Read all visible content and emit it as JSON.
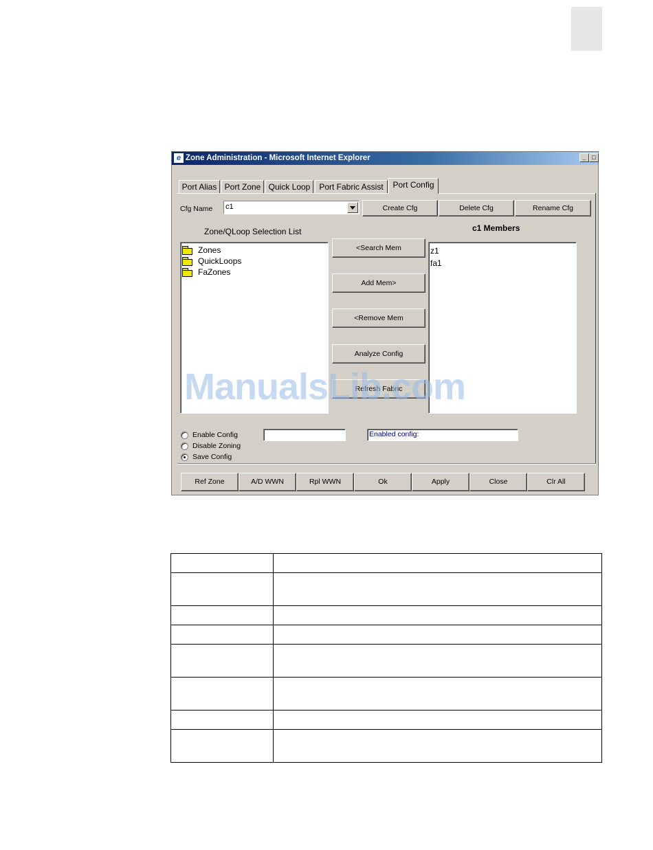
{
  "window": {
    "title": "Zone Administration - Microsoft Internet Explorer",
    "icon": "ie-icon",
    "controls": [
      "minimize-icon",
      "maximize-icon"
    ]
  },
  "tabs": [
    {
      "label": "Port Alias",
      "active": false
    },
    {
      "label": "Port Zone",
      "active": false
    },
    {
      "label": "Quick Loop",
      "active": false
    },
    {
      "label": "Port Fabric Assist",
      "active": false
    },
    {
      "label": "Port Config",
      "active": true
    }
  ],
  "cfg": {
    "name_label": "Cfg Name",
    "name_value": "c1",
    "create_label": "Create Cfg",
    "delete_label": "Delete Cfg",
    "rename_label": "Rename Cfg"
  },
  "selection": {
    "title": "Zone/QLoop Selection List",
    "items": [
      "Zones",
      "QuickLoops",
      "FaZones"
    ]
  },
  "members": {
    "title": "c1 Members",
    "items": [
      "z1",
      "fa1"
    ]
  },
  "actions": {
    "search_mem": "<Search Mem",
    "add_mem": "Add Mem>",
    "remove_mem": "<Remove Mem",
    "analyze_config": "Analyze Config",
    "refresh_fabric": "Refresh Fabric"
  },
  "options": {
    "enable": "Enable Config",
    "disable": "Disable Zoning",
    "save": "Save Config",
    "selected": "save",
    "config_input": "",
    "enabled_config": "Enabled config:"
  },
  "bottom_buttons": [
    "Ref Zone",
    "A/D WWN",
    "Rpl WWN",
    "Ok",
    "Apply",
    "Close",
    "Clr All"
  ],
  "watermark": "ManualsLib.com"
}
